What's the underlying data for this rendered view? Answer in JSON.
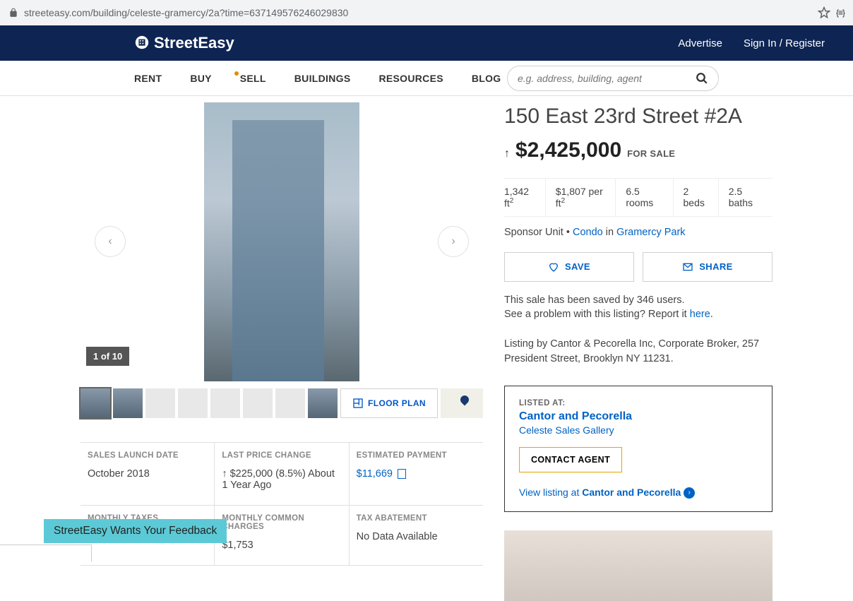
{
  "browser": {
    "url": "streeteasy.com/building/celeste-gramercy/2a?time=637149576246029830"
  },
  "brand": "StreetEasy",
  "top_links": {
    "advertise": "Advertise",
    "sign_in": "Sign In / Register"
  },
  "nav": {
    "rent": "RENT",
    "buy": "BUY",
    "sell": "SELL",
    "buildings": "BUILDINGS",
    "resources": "RESOURCES",
    "blog": "BLOG"
  },
  "search": {
    "placeholder": "e.g. address, building, agent"
  },
  "gallery": {
    "counter": "1 of 10",
    "floor_plan": "FLOOR PLAN"
  },
  "listing": {
    "title": "150 East 23rd Street #2A",
    "price": "$2,425,000",
    "status": "FOR SALE",
    "arrow": "↑"
  },
  "facts": {
    "sqft": "1,342 ft",
    "ppsf": "$1,807 per ft",
    "rooms": "6.5 rooms",
    "beds": "2 beds",
    "baths": "2.5 baths"
  },
  "type_line": {
    "sponsor": "Sponsor Unit",
    "sep": " • ",
    "condo": "Condo",
    "in": " in ",
    "hood": "Gramercy Park"
  },
  "actions": {
    "save": "SAVE",
    "share": "SHARE"
  },
  "meta": {
    "saved": "This sale has been saved by 346 users.",
    "problem_pre": "See a problem with this listing? Report it ",
    "problem_link": "here",
    "period": ".",
    "listing_by": "Listing by Cantor & Pecorella Inc, Corporate Broker, 257 President Street, Brooklyn NY 11231."
  },
  "agent": {
    "listed_at": "LISTED AT:",
    "name": "Cantor and Pecorella",
    "sub": "Celeste Sales Gallery",
    "contact": "CONTACT AGENT",
    "view_pre": "View listing at ",
    "view_name": "Cantor and Pecorella"
  },
  "details": {
    "launch_label": "SALES LAUNCH DATE",
    "launch_value": "October 2018",
    "change_label": "LAST PRICE CHANGE",
    "change_value": "↑ $225,000 (8.5%) About 1 Year Ago",
    "est_label": "ESTIMATED PAYMENT",
    "est_value": "$11,669",
    "taxes_label": "MONTHLY TAXES",
    "taxes_value": "",
    "charges_label": "MONTHLY COMMON CHARGES",
    "charges_value": "$1,753",
    "abate_label": "TAX ABATEMENT",
    "abate_value": "No Data Available"
  },
  "feedback": "StreetEasy Wants Your Feedback"
}
